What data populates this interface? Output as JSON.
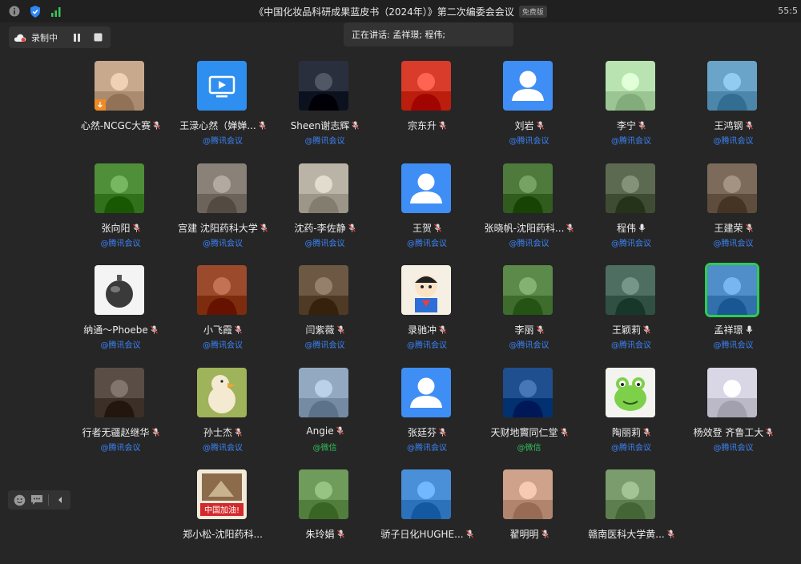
{
  "window": {
    "title": "《中国化妆品科研成果蓝皮书（2024年）》第二次编委会会议",
    "edition_badge": "免费版",
    "clock": "55:5"
  },
  "recording": {
    "label": "录制中"
  },
  "speaking": {
    "label": "正在讲话: 孟祥璟; 程伟;"
  },
  "participants": [
    {
      "name": "心然-NCGC大赛",
      "source": "",
      "mic": "muted",
      "avatar": "photo-woman",
      "color": "#c9a98e",
      "host_badge": true
    },
    {
      "name": "王渌心然（婵婵...",
      "source": "@腾讯会议",
      "mic": "muted",
      "avatar": "screen-share",
      "color": "#2f8ff0"
    },
    {
      "name": "Sheen谢志辉",
      "source": "@腾讯会议",
      "mic": "muted",
      "avatar": "photo-man",
      "color": "#2a2f3d"
    },
    {
      "name": "宗东升",
      "source": "",
      "mic": "muted",
      "avatar": "photo-red",
      "color": "#d93c2a"
    },
    {
      "name": "刘岩",
      "source": "@腾讯会议",
      "mic": "muted",
      "avatar": "default-user",
      "color": "#3f8ef5"
    },
    {
      "name": "李宁",
      "source": "@腾讯会议",
      "mic": "muted",
      "avatar": "photo-green",
      "color": "#b9e3b0"
    },
    {
      "name": "王鸿钢",
      "source": "@腾讯会议",
      "mic": "muted",
      "avatar": "photo-palm",
      "color": "#6aa4c9"
    },
    {
      "name": "张向阳",
      "source": "@腾讯会议",
      "mic": "muted",
      "avatar": "photo-garden",
      "color": "#4f8f3a"
    },
    {
      "name": "宫建 沈阳药科大学",
      "source": "@腾讯会议",
      "mic": "muted",
      "avatar": "photo-face",
      "color": "#8a8178"
    },
    {
      "name": "沈药-李佐静",
      "source": "@腾讯会议",
      "mic": "muted",
      "avatar": "photo-plant",
      "color": "#b9b4a6"
    },
    {
      "name": "王贺",
      "source": "@腾讯会议",
      "mic": "muted",
      "avatar": "default-user",
      "color": "#3f8ef5"
    },
    {
      "name": "张晓帆-沈阳药科...",
      "source": "@腾讯会议",
      "mic": "muted",
      "avatar": "photo-kid",
      "color": "#4e7a3c"
    },
    {
      "name": "程伟",
      "source": "@腾讯会议",
      "mic": "speaking",
      "avatar": "photo-lake",
      "color": "#5d6a52"
    },
    {
      "name": "王建荣",
      "source": "@腾讯会议",
      "mic": "muted",
      "avatar": "photo-hall",
      "color": "#7c6a5a"
    },
    {
      "name": "纳通～Phoebe",
      "source": "@腾讯会议",
      "mic": "muted",
      "avatar": "photo-ornament",
      "color": "#f4f4f4"
    },
    {
      "name": "小飞霞",
      "source": "@腾讯会议",
      "mic": "muted",
      "avatar": "photo-food",
      "color": "#9c4a2c"
    },
    {
      "name": "闫紫薇",
      "source": "@腾讯会议",
      "mic": "muted",
      "avatar": "photo-child",
      "color": "#6d5844"
    },
    {
      "name": "录驰冲",
      "source": "@腾讯会议",
      "mic": "muted",
      "avatar": "cartoon-hero",
      "color": "#f6efe4"
    },
    {
      "name": "李丽",
      "source": "@腾讯会议",
      "mic": "muted",
      "avatar": "photo-park",
      "color": "#5b8a4a"
    },
    {
      "name": "王颖莉",
      "source": "@腾讯会议",
      "mic": "muted",
      "avatar": "photo-canal",
      "color": "#4e6e62"
    },
    {
      "name": "孟祥璟",
      "source": "@腾讯会议",
      "mic": "speaking",
      "avatar": "photo-opera",
      "color": "#4f8ec9",
      "active": true
    },
    {
      "name": "行者无疆赵继华",
      "source": "@腾讯会议",
      "mic": "muted",
      "avatar": "photo-suit",
      "color": "#5a4d45"
    },
    {
      "name": "孙士杰",
      "source": "@腾讯会议",
      "mic": "muted",
      "avatar": "cartoon-duck",
      "color": "#9fb35a"
    },
    {
      "name": "Angie",
      "source": "@微信",
      "source_type": "wx",
      "mic": "muted",
      "avatar": "photo-bridge",
      "color": "#93a9c2"
    },
    {
      "name": "张廷芬",
      "source": "@腾讯会议",
      "mic": "muted",
      "avatar": "default-user",
      "color": "#3f8ef5"
    },
    {
      "name": "天财地竇同仁堂",
      "source": "@微信",
      "source_type": "wx",
      "mic": "muted",
      "avatar": "photo-earth",
      "color": "#1f4f8e"
    },
    {
      "name": "陶丽莉",
      "source": "@腾讯会议",
      "mic": "muted",
      "avatar": "cartoon-frog",
      "color": "#7ed04a"
    },
    {
      "name": "杨效登 齐鲁工大",
      "source": "@腾讯会议",
      "mic": "muted",
      "avatar": "photo-pattern",
      "color": "#d9d6e6"
    },
    {
      "name": "",
      "source": "",
      "mic": "none",
      "avatar": "none"
    },
    {
      "name": "郑小松-沈阳药科...",
      "source": "",
      "mic": "none",
      "avatar": "photo-china",
      "color": "#b9a58a",
      "caption": "中国加油!"
    },
    {
      "name": "朱玲娟",
      "source": "",
      "mic": "muted",
      "avatar": "photo-lotus",
      "color": "#6f9c5a"
    },
    {
      "name": "骄子日化HUGHE...",
      "source": "",
      "mic": "muted",
      "avatar": "photo-sky",
      "color": "#4a90d9"
    },
    {
      "name": "翟明明",
      "source": "",
      "mic": "muted",
      "avatar": "photo-couple",
      "color": "#cfa28c"
    },
    {
      "name": "赣南医科大学黄...",
      "source": "",
      "mic": "muted",
      "avatar": "photo-wedding",
      "color": "#7b9c6c"
    }
  ],
  "toolbar": {
    "emoji_icon": "emoji-icon",
    "chat_icon": "chat-icon",
    "collapse_icon": "chevron-left-icon"
  }
}
